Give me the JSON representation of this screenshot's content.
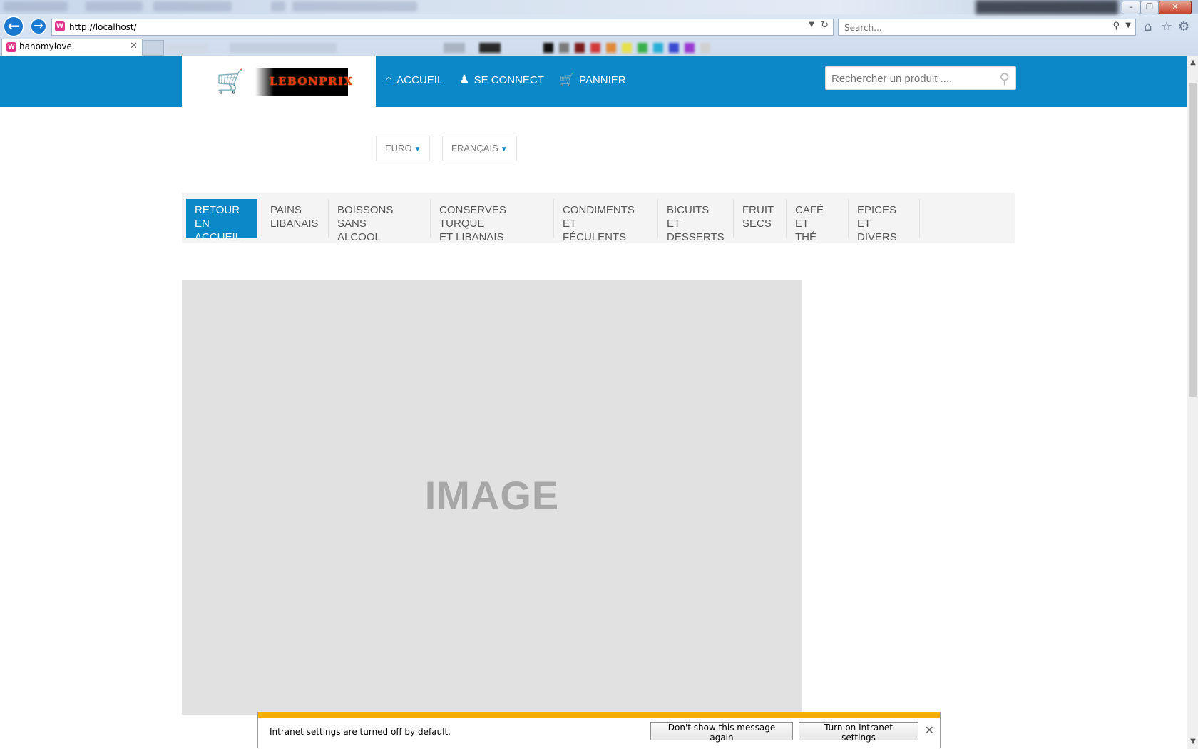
{
  "browser": {
    "address_url": "http://localhost/",
    "search_placeholder": "Search...",
    "tab_title": "hanomylove",
    "tab_favicon_letter": "W",
    "icons": [
      "back-icon",
      "forward-icon",
      "refresh-icon",
      "home-icon",
      "favorites-star-icon",
      "settings-gear-icon"
    ]
  },
  "site": {
    "brand": "LEBONPRIX",
    "nav": [
      {
        "label": "ACCUEIL",
        "icon": "home-icon"
      },
      {
        "label": "SE CONNECT",
        "icon": "user-icon"
      },
      {
        "label": "PANNIER",
        "icon": "cart-icon"
      }
    ],
    "search_placeholder": "Rechercher un produit ....",
    "currency": "EURO",
    "language": "FRANÇAIS",
    "categories": [
      "RETOUR EN\nACCUEIL",
      "PAINS\nLIBANAIS",
      "BOISSONS SANS\nALCOOL",
      "CONSERVES TURQUE\nET LIBANAIS",
      "CONDIMENTS ET\nFÉCULENTS",
      "BICUITS ET\nDESSERTS",
      "FRUIT\nSECS",
      "CAFÉ ET\nTHÉ",
      "EPICES ET\nDIVERS"
    ],
    "hero_text": "IMAGE",
    "colors": {
      "primary": "#0a88c7",
      "accent": "#f07e1b"
    }
  },
  "notification": {
    "message": "Intranet settings are turned off by default.",
    "button_dismiss": "Don't show this message again",
    "button_enable": "Turn on Intranet settings"
  }
}
